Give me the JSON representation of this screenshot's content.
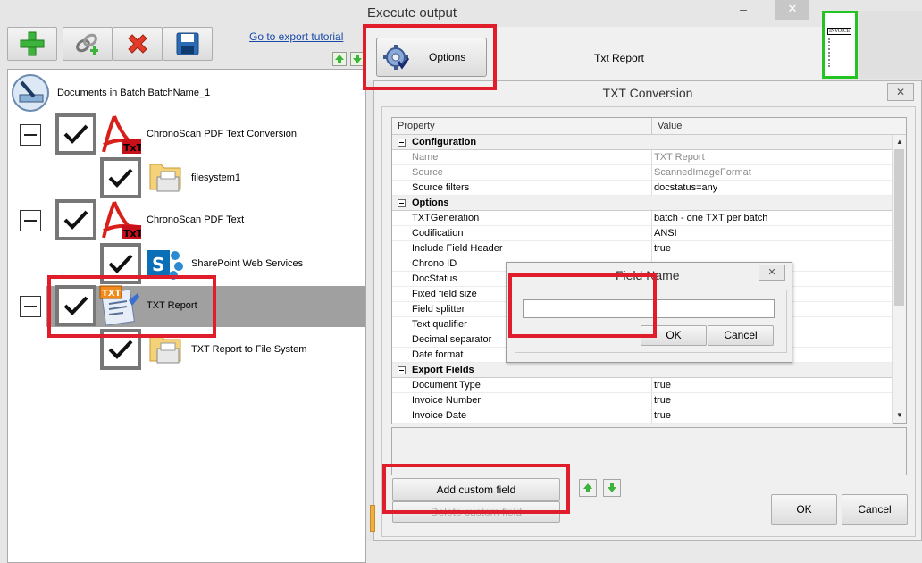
{
  "window": {
    "title": "Execute output",
    "min_glyph": "–",
    "close_glyph": "✕"
  },
  "toolbar": {
    "tutorial_link": "Go to export tutorial",
    "buttons": [
      "add",
      "link",
      "delete",
      "save"
    ]
  },
  "tree": {
    "root_label": "Documents in Batch BatchName_1",
    "nodes": [
      {
        "label": "ChronoScan PDF Text Conversion",
        "level": 1
      },
      {
        "label": "filesystem1",
        "level": 2
      },
      {
        "label": "ChronoScan PDF Text",
        "level": 1
      },
      {
        "label": "SharePoint Web Services",
        "level": 2
      },
      {
        "label": "TXT Report",
        "level": 1,
        "selected": true
      },
      {
        "label": "TXT Report to File System",
        "level": 2
      }
    ]
  },
  "header": {
    "options_label": "Options",
    "current_output": "Txt Report",
    "thumbnail_text": "INVOICE"
  },
  "txt_dialog": {
    "title": "TXT Conversion",
    "close_glyph": "✕",
    "columns": [
      "Property",
      "Value"
    ],
    "rows": [
      {
        "type": "cat",
        "p": "Configuration"
      },
      {
        "type": "dim",
        "p": "Name",
        "v": "TXT Report"
      },
      {
        "type": "dim",
        "p": "Source",
        "v": "ScannedImageFormat"
      },
      {
        "type": "row",
        "p": "Source filters",
        "v": "docstatus=any"
      },
      {
        "type": "cat",
        "p": "Options"
      },
      {
        "type": "row",
        "p": "TXTGeneration",
        "v": "batch - one TXT per batch"
      },
      {
        "type": "row",
        "p": "Codification",
        "v": "ANSI"
      },
      {
        "type": "row",
        "p": "Include Field Header",
        "v": "true"
      },
      {
        "type": "row",
        "p": "Chrono ID",
        "v": ""
      },
      {
        "type": "row",
        "p": "DocStatus",
        "v": ""
      },
      {
        "type": "row",
        "p": "Fixed field size",
        "v": ""
      },
      {
        "type": "row",
        "p": "Field splitter",
        "v": ""
      },
      {
        "type": "row",
        "p": "Text qualifier",
        "v": ""
      },
      {
        "type": "row",
        "p": "Decimal separator",
        "v": ""
      },
      {
        "type": "row",
        "p": "Date format",
        "v": ""
      },
      {
        "type": "cat",
        "p": "Export Fields"
      },
      {
        "type": "row",
        "p": "Document Type",
        "v": "true"
      },
      {
        "type": "row",
        "p": "Invoice Number",
        "v": "true"
      },
      {
        "type": "row",
        "p": "Invoice Date",
        "v": "true"
      }
    ],
    "add_custom_label": "Add custom field",
    "delete_custom_label": "Delete custom field",
    "ok_label": "OK",
    "cancel_label": "Cancel"
  },
  "field_name_dialog": {
    "title": "Field Name",
    "close_glyph": "✕",
    "value": "",
    "ok_label": "OK",
    "cancel_label": "Cancel"
  },
  "colors": {
    "highlight_red": "#e01e2b",
    "selection_gray": "#a0a0a0",
    "thumbnail_green": "#22c322"
  }
}
